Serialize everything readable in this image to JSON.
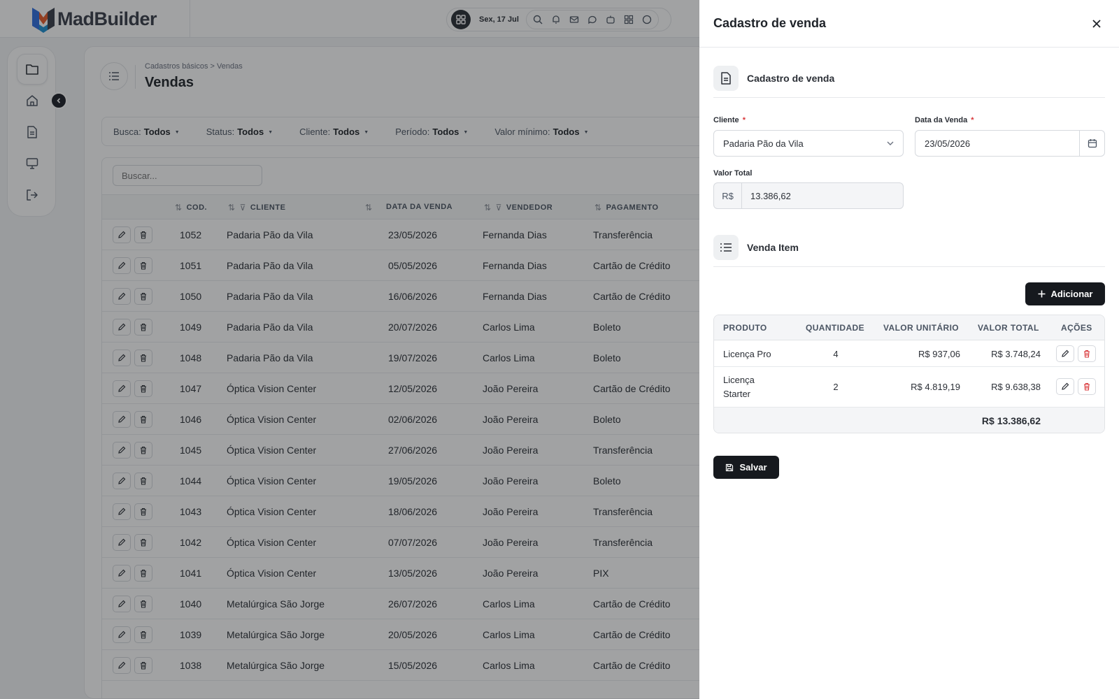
{
  "app": {
    "brand": "MadBuilder"
  },
  "topbar": {
    "date": "Sex, 17 Jul"
  },
  "page": {
    "breadcrumb": "Cadastros básicos > Vendas",
    "title": "Vendas"
  },
  "filters": [
    {
      "label": "Busca:",
      "value": "Todos"
    },
    {
      "label": "Status:",
      "value": "Todos"
    },
    {
      "label": "Cliente:",
      "value": "Todos"
    },
    {
      "label": "Período:",
      "value": "Todos"
    },
    {
      "label": "Valor mínimo:",
      "value": "Todos"
    }
  ],
  "table": {
    "search_placeholder": "Buscar...",
    "columns": {
      "cod": "COD.",
      "cliente": "CLIENTE",
      "data": "DATA DA VENDA",
      "vendedor": "VENDEDOR",
      "pagamento": "PAGAMENTO"
    },
    "rows": [
      {
        "cod": "1052",
        "cliente": "Padaria Pão da Vila",
        "data": "23/05/2026",
        "vendedor": "Fernanda Dias",
        "pagamento": "Transferência"
      },
      {
        "cod": "1051",
        "cliente": "Padaria Pão da Vila",
        "data": "05/05/2026",
        "vendedor": "Fernanda Dias",
        "pagamento": "Cartão de Crédito"
      },
      {
        "cod": "1050",
        "cliente": "Padaria Pão da Vila",
        "data": "16/06/2026",
        "vendedor": "Fernanda Dias",
        "pagamento": "Cartão de Crédito"
      },
      {
        "cod": "1049",
        "cliente": "Padaria Pão da Vila",
        "data": "20/07/2026",
        "vendedor": "Carlos Lima",
        "pagamento": "Boleto"
      },
      {
        "cod": "1048",
        "cliente": "Padaria Pão da Vila",
        "data": "19/07/2026",
        "vendedor": "Carlos Lima",
        "pagamento": "Boleto"
      },
      {
        "cod": "1047",
        "cliente": "Óptica Vision Center",
        "data": "12/05/2026",
        "vendedor": "João Pereira",
        "pagamento": "Cartão de Crédito"
      },
      {
        "cod": "1046",
        "cliente": "Óptica Vision Center",
        "data": "02/06/2026",
        "vendedor": "João Pereira",
        "pagamento": "Boleto"
      },
      {
        "cod": "1045",
        "cliente": "Óptica Vision Center",
        "data": "27/06/2026",
        "vendedor": "João Pereira",
        "pagamento": "Transferência"
      },
      {
        "cod": "1044",
        "cliente": "Óptica Vision Center",
        "data": "19/05/2026",
        "vendedor": "João Pereira",
        "pagamento": "Boleto"
      },
      {
        "cod": "1043",
        "cliente": "Óptica Vision Center",
        "data": "18/06/2026",
        "vendedor": "João Pereira",
        "pagamento": "Transferência"
      },
      {
        "cod": "1042",
        "cliente": "Óptica Vision Center",
        "data": "07/07/2026",
        "vendedor": "João Pereira",
        "pagamento": "Transferência"
      },
      {
        "cod": "1041",
        "cliente": "Óptica Vision Center",
        "data": "13/05/2026",
        "vendedor": "João Pereira",
        "pagamento": "PIX"
      },
      {
        "cod": "1040",
        "cliente": "Metalúrgica São Jorge",
        "data": "26/07/2026",
        "vendedor": "Carlos Lima",
        "pagamento": "Cartão de Crédito"
      },
      {
        "cod": "1039",
        "cliente": "Metalúrgica São Jorge",
        "data": "20/05/2026",
        "vendedor": "Carlos Lima",
        "pagamento": "Cartão de Crédito"
      },
      {
        "cod": "1038",
        "cliente": "Metalúrgica São Jorge",
        "data": "15/05/2026",
        "vendedor": "Carlos Lima",
        "pagamento": "Cartão de Crédito"
      }
    ]
  },
  "panel": {
    "title": "Cadastro de venda",
    "section1": "Cadastro de venda",
    "cliente_label": "Cliente",
    "cliente_value": "Padaria Pão da Vila",
    "data_label": "Data da Venda",
    "data_value": "23/05/2026",
    "required_mark": "*",
    "valor_label": "Valor Total",
    "currency_prefix": "R$",
    "valor_value": "13.386,62",
    "section2": "Venda Item",
    "add_label": "Adicionar",
    "items_columns": {
      "produto": "PRODUTO",
      "quantidade": "QUANTIDADE",
      "unitario": "VALOR UNITÁRIO",
      "total": "VALOR TOTAL",
      "acoes": "AÇÕES"
    },
    "items": [
      {
        "produto": "Licença Pro",
        "quantidade": "4",
        "unitario": "R$ 937,06",
        "total": "R$ 3.748,24"
      },
      {
        "produto_line1": "Licença",
        "produto_line2": "Starter",
        "quantidade": "2",
        "unitario": "R$ 4.819,19",
        "total": "R$ 9.638,38"
      }
    ],
    "items_total": "R$ 13.386,62",
    "save_label": "Salvar"
  },
  "colors": {
    "accent": "#16191e",
    "danger": "#d9373a",
    "overlay": "rgba(20,22,26,0.4)"
  }
}
